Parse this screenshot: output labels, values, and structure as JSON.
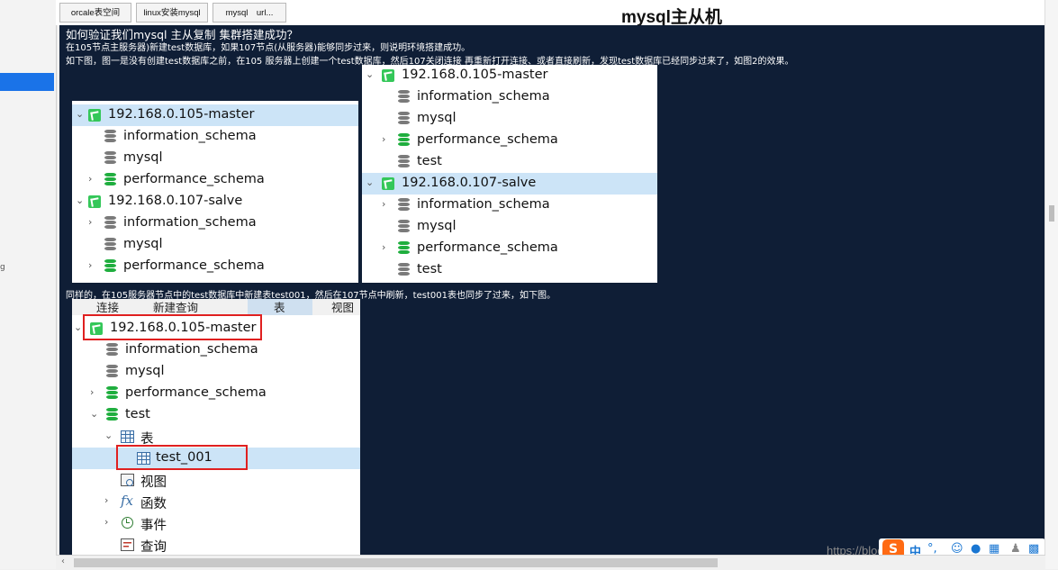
{
  "tabs": [
    "orcale表空间",
    "linux安装mysql",
    "mysql　url..."
  ],
  "doc": {
    "title": "mysql主从机",
    "heading": "如何验证我们mysql 主从复制 集群搭建成功？",
    "para1": "在105节点主服务器)新建test数据库，如果107节点(从服务器)能够同步过来，则说明环境搭建成功。",
    "para2": "如下图，图一是没有创建test数据库之前，在105 服务器上创建一个test数据库，然后107关闭连接 再重新打开连接、或者直接刷新，发现test数据库已经同步过来了，如图2的效果。",
    "para3": "同样的，在105服务器节点中的test数据库中新建表test001，然后在107节点中刷新，test001表也同步了过来，如下图。"
  },
  "panel1": {
    "rows": [
      {
        "label": "192.168.0.105-master",
        "type": "connection",
        "expanded": true,
        "selected": true
      },
      {
        "label": "information_schema",
        "type": "db-gray"
      },
      {
        "label": "mysql",
        "type": "db-gray"
      },
      {
        "label": "performance_schema",
        "type": "db-green",
        "expandable": true
      },
      {
        "label": "192.168.0.107-salve",
        "type": "connection",
        "expanded": true
      },
      {
        "label": "information_schema",
        "type": "db-gray",
        "expandable": true
      },
      {
        "label": "mysql",
        "type": "db-gray"
      },
      {
        "label": "performance_schema",
        "type": "db-green",
        "expandable": true
      }
    ]
  },
  "panel2": {
    "rows": [
      {
        "label": "192.168.0.105-master",
        "type": "connection",
        "expanded": true
      },
      {
        "label": "information_schema",
        "type": "db-gray"
      },
      {
        "label": "mysql",
        "type": "db-gray"
      },
      {
        "label": "performance_schema",
        "type": "db-green",
        "expandable": true
      },
      {
        "label": "test",
        "type": "db-gray"
      },
      {
        "label": "192.168.0.107-salve",
        "type": "connection",
        "expanded": true,
        "selected": true
      },
      {
        "label": "information_schema",
        "type": "db-gray",
        "expandable": true
      },
      {
        "label": "mysql",
        "type": "db-gray"
      },
      {
        "label": "performance_schema",
        "type": "db-green",
        "expandable": true
      },
      {
        "label": "test",
        "type": "db-gray"
      }
    ]
  },
  "panel3": {
    "toolbar": [
      "连接",
      "新建查询",
      "表",
      "视图"
    ],
    "rows": [
      {
        "label": "192.168.0.105-master",
        "type": "connection",
        "expanded": true
      },
      {
        "label": "information_schema",
        "type": "db-gray"
      },
      {
        "label": "mysql",
        "type": "db-gray"
      },
      {
        "label": "performance_schema",
        "type": "db-green",
        "expandable": true
      },
      {
        "label": "test",
        "type": "db-green",
        "expanded": true
      },
      {
        "label": "表",
        "type": "table-group",
        "expanded": true
      },
      {
        "label": "test_001",
        "type": "table",
        "selected": true
      },
      {
        "label": "视图",
        "type": "view"
      },
      {
        "label": "函数",
        "type": "function",
        "expandable": true
      },
      {
        "label": "事件",
        "type": "event",
        "expandable": true
      },
      {
        "label": "查询",
        "type": "query"
      }
    ]
  },
  "watermark": "https://blog.csdn.net/...",
  "tray": {
    "ime": "中",
    "punct": "°,"
  },
  "colors": {
    "doc_bg": "#0f1e36",
    "selection": "#cce4f7",
    "highlight_box": "#e02020",
    "db_green": "#1fae3e"
  }
}
